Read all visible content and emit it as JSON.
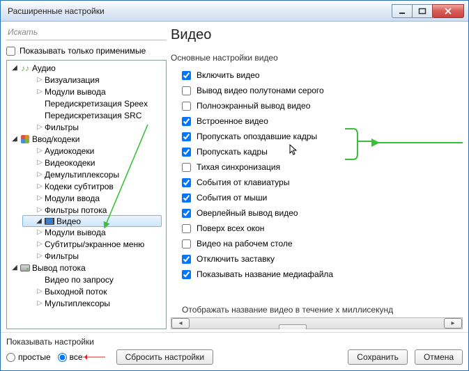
{
  "window": {
    "title": "Расширенные настройки"
  },
  "search": {
    "placeholder": "Искать",
    "only_applicable_label": "Показывать только применимые"
  },
  "tree": {
    "items": [
      {
        "label": "Аудио",
        "depth": 0,
        "expanded": true,
        "icon": "audio"
      },
      {
        "label": "Визуализация",
        "depth": 1,
        "expandable": true
      },
      {
        "label": "Модули вывода",
        "depth": 1,
        "expandable": true
      },
      {
        "label": "Передискретизация Speex",
        "depth": 1
      },
      {
        "label": "Передискретизация SRC",
        "depth": 1
      },
      {
        "label": "Фильтры",
        "depth": 1,
        "expandable": true
      },
      {
        "label": "Ввод/кодеки",
        "depth": 0,
        "expanded": true,
        "icon": "blocks"
      },
      {
        "label": "Аудиокодеки",
        "depth": 1,
        "expandable": true
      },
      {
        "label": "Видеокодеки",
        "depth": 1,
        "expandable": true
      },
      {
        "label": "Демультиплексоры",
        "depth": 1,
        "expandable": true
      },
      {
        "label": "Кодеки субтитров",
        "depth": 1,
        "expandable": true
      },
      {
        "label": "Модули ввода",
        "depth": 1,
        "expandable": true
      },
      {
        "label": "Фильтры потока",
        "depth": 1,
        "expandable": true
      },
      {
        "label": "Видео",
        "depth": 0,
        "expanded": true,
        "icon": "film",
        "selected": true
      },
      {
        "label": "Модули вывода",
        "depth": 1,
        "expandable": true
      },
      {
        "label": "Субтитры/экранное меню",
        "depth": 1,
        "expandable": true
      },
      {
        "label": "Фильтры",
        "depth": 1,
        "expandable": true
      },
      {
        "label": "Вывод потока",
        "depth": 0,
        "expanded": true,
        "icon": "drive"
      },
      {
        "label": "Видео по запросу",
        "depth": 1
      },
      {
        "label": "Выходной поток",
        "depth": 1,
        "expandable": true
      },
      {
        "label": "Мультиплексоры",
        "depth": 1,
        "expandable": true
      }
    ]
  },
  "right": {
    "heading": "Видео",
    "section": "Основные настройки видео",
    "options": [
      {
        "label": "Включить видео",
        "checked": true
      },
      {
        "label": "Вывод видео полутонами серого",
        "checked": false
      },
      {
        "label": "Полноэкранный вывод видео",
        "checked": false
      },
      {
        "label": "Встроенное видео",
        "checked": true
      },
      {
        "label": "Пропускать опоздавшие кадры",
        "checked": true
      },
      {
        "label": "Пропускать кадры",
        "checked": true
      },
      {
        "label": "Тихая синхронизация",
        "checked": false
      },
      {
        "label": "События от клавиатуры",
        "checked": true
      },
      {
        "label": "События от мыши",
        "checked": true
      },
      {
        "label": "Оверлейный вывод видео",
        "checked": true
      },
      {
        "label": "Поверх всех окон",
        "checked": false
      },
      {
        "label": "Видео на рабочем столе",
        "checked": false
      },
      {
        "label": "Отключить заставку",
        "checked": true
      },
      {
        "label": "Показывать название медиафайла",
        "checked": true
      }
    ],
    "more_label": "Отображать название видео в течение х миллисекунд"
  },
  "footer": {
    "show_label": "Показывать настройки",
    "radio_simple": "простые",
    "radio_all": "все",
    "reset": "Сбросить настройки",
    "save": "Сохранить",
    "cancel": "Отмена"
  }
}
